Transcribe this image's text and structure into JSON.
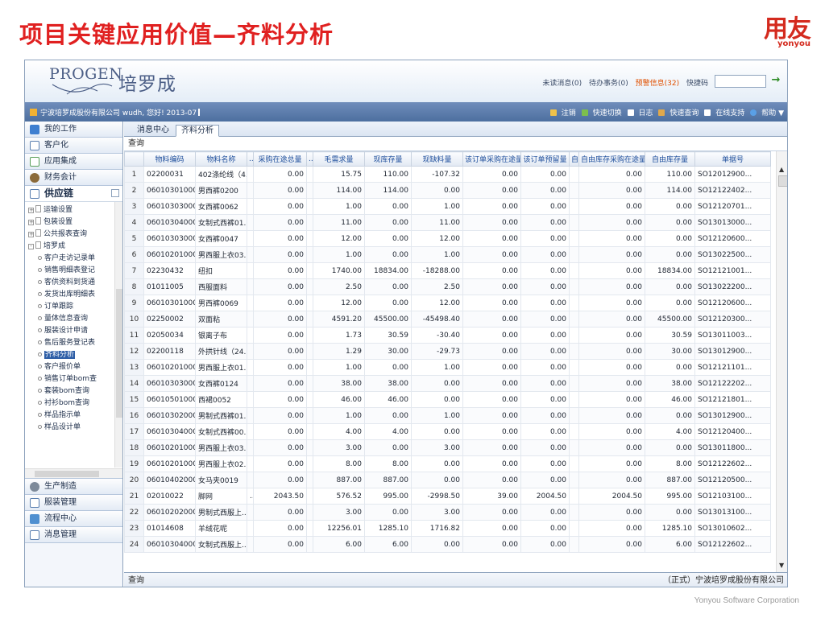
{
  "slide": {
    "title": "项目关键应用价值—齐料分析",
    "brand": "用友",
    "brand_sub": "yonyou",
    "footer": "Yonyou Software Corporation"
  },
  "app": {
    "logo_en": "PROGEN",
    "logo_cn": "培罗成",
    "header_links": {
      "unread": "未读消息(0)",
      "todo": "待办事务(0)",
      "warning": "预警信息(32)",
      "quick_code": "快捷码"
    },
    "bar_left": "宁波培罗成股份有限公司 wudh, 您好! 2013-07",
    "bar_right": [
      "注销",
      "快速切换",
      "日志",
      "快速查询",
      "在线支持",
      "帮助"
    ],
    "modules_top": [
      "我的工作",
      "客户化",
      "应用集成",
      "财务会计",
      "供应链"
    ],
    "tree_top": [
      "运输设置",
      "包装设置",
      "公共报表查询",
      "培罗成"
    ],
    "tree_children": [
      "客户走访记录单",
      "销售明细表登记",
      "客供资料到货通",
      "发货出库明细表",
      "订单跟踪",
      "量体信息查询",
      "服装设计申请",
      "售后服务登记表",
      "齐料分析",
      "客户报价单",
      "销售订单bom查",
      "套装bom查询",
      "衬衫bom查询",
      "样品指示单",
      "样品设计单"
    ],
    "modules_bottom": [
      "生产制造",
      "服装管理",
      "流程中心",
      "消息管理"
    ],
    "tabs": [
      "消息中心",
      "齐料分析"
    ],
    "query_label": "查询",
    "status_left": "查询",
    "status_right": "（正式）宁波培罗成股份有限公司"
  },
  "table": {
    "columns": [
      "",
      "物料编码",
      "物料名称",
      "...",
      "采购在途总量",
      "...",
      "毛需求量",
      "现库存量",
      "现缺料量",
      "该订单采购在途量",
      "该订单预留量",
      "自...",
      "自由库存采购在途量",
      "自由库存量",
      "单据号"
    ],
    "rows": [
      [
        "1",
        "02200031",
        "402涤纶线（4...",
        "",
        "0.00",
        "",
        "15.75",
        "110.00",
        "-107.32",
        "0.00",
        "0.00",
        "",
        "0.00",
        "110.00",
        "SO12012900..."
      ],
      [
        "2",
        "06010301000...",
        "男西裤0200",
        "",
        "0.00",
        "",
        "114.00",
        "114.00",
        "0.00",
        "0.00",
        "0.00",
        "",
        "0.00",
        "114.00",
        "SO12122402..."
      ],
      [
        "3",
        "06010303000...",
        "女西裤0062",
        "",
        "0.00",
        "",
        "1.00",
        "0.00",
        "1.00",
        "0.00",
        "0.00",
        "",
        "0.00",
        "0.00",
        "SO12120701..."
      ],
      [
        "4",
        "06010304000...",
        "女制式西裤01...",
        "",
        "0.00",
        "",
        "11.00",
        "0.00",
        "11.00",
        "0.00",
        "0.00",
        "",
        "0.00",
        "0.00",
        "SO13013000..."
      ],
      [
        "5",
        "06010303000...",
        "女西裤0047",
        "",
        "0.00",
        "",
        "12.00",
        "0.00",
        "12.00",
        "0.00",
        "0.00",
        "",
        "0.00",
        "0.00",
        "SO12120600..."
      ],
      [
        "6",
        "06010201000...",
        "男西服上衣03...",
        "",
        "0.00",
        "",
        "1.00",
        "0.00",
        "1.00",
        "0.00",
        "0.00",
        "",
        "0.00",
        "0.00",
        "SO13022500..."
      ],
      [
        "7",
        "02230432",
        "纽扣",
        "",
        "0.00",
        "",
        "1740.00",
        "18834.00",
        "-18288.00",
        "0.00",
        "0.00",
        "",
        "0.00",
        "18834.00",
        "SO12121001..."
      ],
      [
        "8",
        "01011005",
        "西服面料",
        "",
        "0.00",
        "",
        "2.50",
        "0.00",
        "2.50",
        "0.00",
        "0.00",
        "",
        "0.00",
        "0.00",
        "SO13022200..."
      ],
      [
        "9",
        "06010301000...",
        "男西裤0069",
        "",
        "0.00",
        "",
        "12.00",
        "0.00",
        "12.00",
        "0.00",
        "0.00",
        "",
        "0.00",
        "0.00",
        "SO12120600..."
      ],
      [
        "10",
        "02250002",
        "双面粘",
        "",
        "0.00",
        "",
        "4591.20",
        "45500.00",
        "-45498.40",
        "0.00",
        "0.00",
        "",
        "0.00",
        "45500.00",
        "SO12120300..."
      ],
      [
        "11",
        "02050034",
        "银离子布",
        "",
        "0.00",
        "",
        "1.73",
        "30.59",
        "-30.40",
        "0.00",
        "0.00",
        "",
        "0.00",
        "30.59",
        "SO13011003..."
      ],
      [
        "12",
        "02200118",
        "外拱针线（24...",
        "",
        "0.00",
        "",
        "1.29",
        "30.00",
        "-29.73",
        "0.00",
        "0.00",
        "",
        "0.00",
        "30.00",
        "SO13012900..."
      ],
      [
        "13",
        "06010201000...",
        "男西服上衣01...",
        "",
        "0.00",
        "",
        "1.00",
        "0.00",
        "1.00",
        "0.00",
        "0.00",
        "",
        "0.00",
        "0.00",
        "SO12121101..."
      ],
      [
        "14",
        "06010303000...",
        "女西裤0124",
        "",
        "0.00",
        "",
        "38.00",
        "38.00",
        "0.00",
        "0.00",
        "0.00",
        "",
        "0.00",
        "38.00",
        "SO12122202..."
      ],
      [
        "15",
        "06010501000...",
        "西裙0052",
        "",
        "0.00",
        "",
        "46.00",
        "46.00",
        "0.00",
        "0.00",
        "0.00",
        "",
        "0.00",
        "46.00",
        "SO12121801..."
      ],
      [
        "16",
        "06010302000...",
        "男制式西裤01...",
        "",
        "0.00",
        "",
        "1.00",
        "0.00",
        "1.00",
        "0.00",
        "0.00",
        "",
        "0.00",
        "0.00",
        "SO13012900..."
      ],
      [
        "17",
        "06010304000...",
        "女制式西裤00...",
        "",
        "0.00",
        "",
        "4.00",
        "4.00",
        "0.00",
        "0.00",
        "0.00",
        "",
        "0.00",
        "4.00",
        "SO12120400..."
      ],
      [
        "18",
        "06010201000...",
        "男西服上衣03...",
        "",
        "0.00",
        "",
        "3.00",
        "0.00",
        "3.00",
        "0.00",
        "0.00",
        "",
        "0.00",
        "0.00",
        "SO13011800..."
      ],
      [
        "19",
        "06010201000...",
        "男西服上衣02...",
        "",
        "0.00",
        "",
        "8.00",
        "8.00",
        "0.00",
        "0.00",
        "0.00",
        "",
        "0.00",
        "8.00",
        "SO12122602..."
      ],
      [
        "20",
        "06010402000...",
        "女马夹0019",
        "",
        "0.00",
        "",
        "887.00",
        "887.00",
        "0.00",
        "0.00",
        "0.00",
        "",
        "0.00",
        "887.00",
        "SO12120500..."
      ],
      [
        "21",
        "02010022",
        "脚网",
        "...",
        "2043.50",
        "",
        "576.52",
        "995.00",
        "-2998.50",
        "39.00",
        "2004.50",
        "",
        "2004.50",
        "995.00",
        "SO12103100..."
      ],
      [
        "22",
        "06010202000...",
        "男制式西服上...",
        "",
        "0.00",
        "",
        "3.00",
        "0.00",
        "3.00",
        "0.00",
        "0.00",
        "",
        "0.00",
        "0.00",
        "SO13013100..."
      ],
      [
        "23",
        "01014608",
        "羊绒花呢",
        "",
        "0.00",
        "",
        "12256.01",
        "1285.10",
        "1716.82",
        "0.00",
        "0.00",
        "",
        "0.00",
        "1285.10",
        "SO13010602..."
      ],
      [
        "24",
        "06010304000...",
        "女制式西服上...",
        "",
        "0.00",
        "",
        "6.00",
        "6.00",
        "0.00",
        "0.00",
        "0.00",
        "",
        "0.00",
        "6.00",
        "SO12122602..."
      ]
    ]
  },
  "colors": {
    "title_red": "#e02020",
    "brand_red": "#d42a1e",
    "bar_blue": "#4d6f9f",
    "header_text_blue": "#1f4f9c"
  }
}
